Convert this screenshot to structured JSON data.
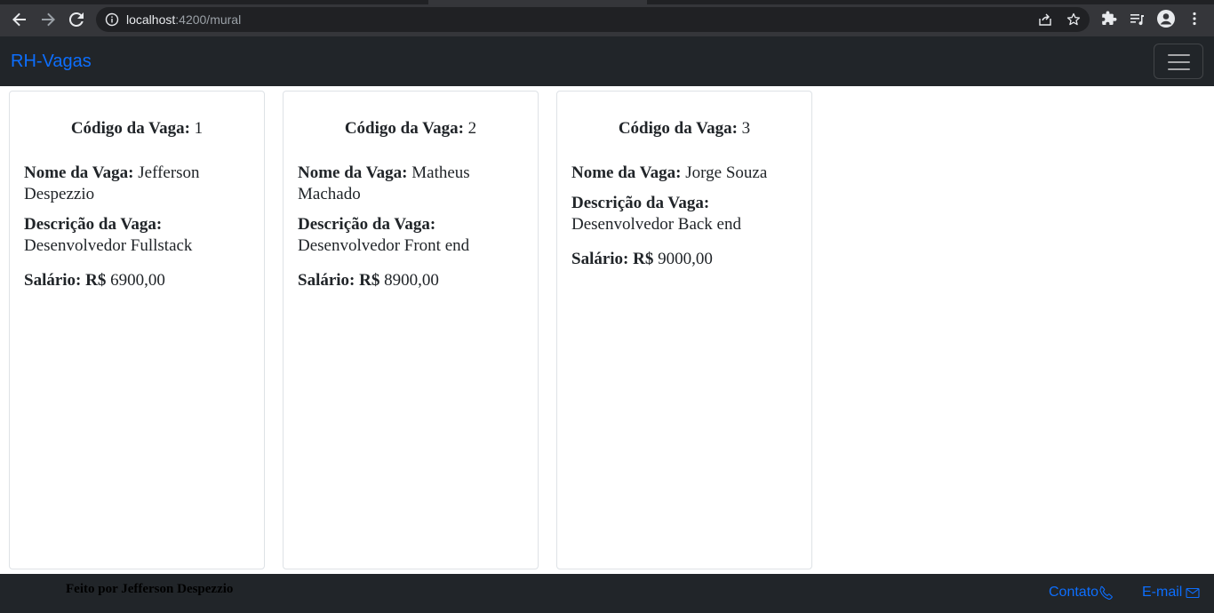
{
  "browser": {
    "url_host": "localhost",
    "url_path": ":4200/mural",
    "icons": [
      "back-icon",
      "forward-icon",
      "reload-icon",
      "info-icon",
      "share-icon",
      "star-icon",
      "extensions-icon",
      "reading-list-icon",
      "profile-icon",
      "menu-dots-icon"
    ]
  },
  "navbar": {
    "brand": "RH-Vagas",
    "toggler_icon": "hamburger-icon"
  },
  "cards": [
    {
      "code_label": "Código da Vaga:",
      "code_value": " 1",
      "name_label": "Nome da Vaga:",
      "name_value": " Jefferson Despezzio",
      "desc_label": "Descrição da Vaga:",
      "desc_value": " Desenvolvedor Fullstack",
      "salary_label": "Salário: R$",
      "salary_value": " 6900,00"
    },
    {
      "code_label": "Código da Vaga:",
      "code_value": " 2",
      "name_label": "Nome da Vaga:",
      "name_value": " Matheus Machado",
      "desc_label": "Descrição da Vaga:",
      "desc_value": " Desenvolvedor Front end",
      "salary_label": "Salário: R$",
      "salary_value": " 8900,00"
    },
    {
      "code_label": "Código da Vaga:",
      "code_value": " 3",
      "name_label": "Nome da Vaga:",
      "name_value": " Jorge Souza",
      "desc_label": "Descrição da Vaga:",
      "desc_value": " Desenvolvedor Back end",
      "salary_label": "Salário: R$",
      "salary_value": " 9000,00"
    }
  ],
  "footer": {
    "credit": "Feito por Jefferson Despezzio",
    "contact_label": "Contato",
    "email_label": "E-mail"
  },
  "colors": {
    "navbar_bg": "#212529",
    "brand_link": "#0d6efd",
    "chrome_bg": "#35363a"
  }
}
